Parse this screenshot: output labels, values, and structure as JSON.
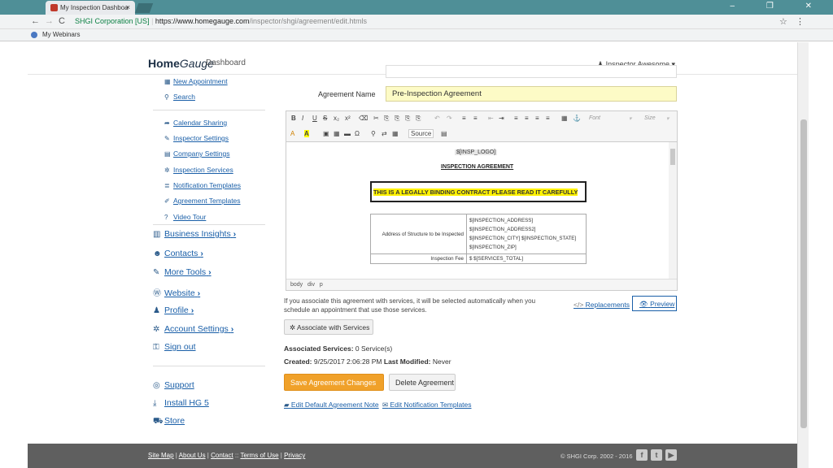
{
  "browser": {
    "tab_title": "My Inspection Dashboa",
    "tab_close": "×",
    "window_controls": "– ❐ ✕",
    "nav_back": "←",
    "nav_forward": "→",
    "nav_reload": "C",
    "secure_label": "SHGI Corporation [US]",
    "url_domain": "https://www.homegauge.com",
    "url_path": "/inspector/shgi/agreement/edit.htmls",
    "bookmark": "My Webinars",
    "star": "☆",
    "menu": "⋮"
  },
  "header": {
    "logo_home": "Home",
    "logo_gauge": "Gauge",
    "logo_sub": "Dashboard",
    "user": "Inspector Awesome"
  },
  "sidebar": {
    "links": [
      {
        "label": "New Appointment",
        "icon": "calendar-icon",
        "glyph": "▦"
      },
      {
        "label": "Search",
        "icon": "search-icon",
        "glyph": "⚲"
      },
      {
        "label": "Calendar Sharing",
        "icon": "share-icon",
        "glyph": "➦"
      },
      {
        "label": "Inspector Settings",
        "icon": "wrench-icon",
        "glyph": "✎"
      },
      {
        "label": "Company Settings",
        "icon": "building-icon",
        "glyph": "▤"
      },
      {
        "label": "Inspection Services",
        "icon": "gear-icon",
        "glyph": "✲"
      },
      {
        "label": "Notification Templates",
        "icon": "list-icon",
        "glyph": "≣"
      },
      {
        "label": "Agreement Templates",
        "icon": "edit-icon",
        "glyph": "✐"
      },
      {
        "label": "Video Tour",
        "icon": "help-icon",
        "glyph": "?"
      }
    ],
    "big_links": [
      {
        "label": "Business Insights",
        "icon": "chart-icon",
        "glyph": "▥"
      },
      {
        "label": "Contacts",
        "icon": "users-icon",
        "glyph": "☻"
      },
      {
        "label": "More Tools",
        "icon": "wrench-icon",
        "glyph": "✎"
      },
      {
        "label": "Website",
        "icon": "wordpress-icon",
        "glyph": "Ⓦ"
      },
      {
        "label": "Profile",
        "icon": "user-icon",
        "glyph": "♟"
      },
      {
        "label": "Account Settings",
        "icon": "gear-icon",
        "glyph": "✲"
      },
      {
        "label": "Sign out",
        "icon": "lock-icon",
        "glyph": "⚿"
      }
    ],
    "support_links": [
      {
        "label": "Support",
        "icon": "lifebuoy-icon",
        "glyph": "◎"
      },
      {
        "label": "Install HG 5",
        "icon": "download-icon",
        "glyph": "⤓"
      },
      {
        "label": "Store",
        "icon": "cart-icon",
        "glyph": "⛟"
      }
    ]
  },
  "form": {
    "agreement_name_label": "Agreement Name",
    "agreement_name_value": "Pre-Inspection Agreement"
  },
  "editor": {
    "toolbar_row1": [
      "B",
      "I",
      "U",
      "S",
      "x₂",
      "x²",
      "⌫",
      "✂",
      "⎘",
      "⎘",
      "⎘",
      "⎘",
      "↶",
      "↷",
      "≡",
      "≡",
      "⇤",
      "⇥",
      "≡",
      "≡",
      "≡",
      "≡",
      "▦",
      "⚓"
    ],
    "font_label": "Font",
    "size_label": "Size",
    "toolbar_row2": [
      "A",
      "A",
      "▣",
      "▦",
      "▬",
      "Ω",
      "⚲",
      "⇄",
      "▦"
    ],
    "source_label": "Source",
    "doc": {
      "logo_tag": "$[INSP_LOGO]",
      "heading": "INSPECTION AGREEMENT",
      "contract_line": "THIS IS A LEGALLY BINDING CONTRACT PLEASE READ IT CAREFULLY",
      "address_label": "Address of Structure to be Inspected",
      "address_values": [
        "$[INSPECTION_ADDRESS]",
        "$[INSPECTION_ADDRESS2]",
        "$[INSPECTION_CITY] $[INSPECTION_STATE]",
        "$[INSPECTION_ZIP]"
      ],
      "fee_label": "Inspection Fee",
      "fee_value": "$ $[SERVICES_TOTAL]"
    },
    "path": [
      "body",
      "div",
      "p"
    ]
  },
  "associate": {
    "note": "If you associate this agreement with services, it will be selected automatically when you schedule an appointment that use those services.",
    "replacements": "Replacements",
    "preview": "Preview",
    "button": "Associate with Services",
    "services_label": "Associated Services:",
    "services_value": "0 Service(s)",
    "created_label": "Created:",
    "created_value": "9/25/2017 2:06:28 PM",
    "modified_label": "Last Modified:",
    "modified_value": "Never"
  },
  "actions": {
    "save": "Save Agreement Changes",
    "delete": "Delete Agreement",
    "edit_note": "Edit Default Agreement Note",
    "edit_templates": "Edit Notification Templates"
  },
  "footer": {
    "links": [
      "Site Map",
      "About Us",
      "Contact",
      "Terms of Use",
      "Privacy"
    ],
    "copyright": "© SHGI Corp. 2002 - 2016",
    "social": [
      "f",
      "t",
      "▶"
    ]
  },
  "colors": {
    "accent": "#1a5fa8",
    "save": "#f0a12a",
    "highlight": "#fff200",
    "input_bg": "#fdfbc6",
    "tab_bar": "#4f8f97",
    "footer": "#5f5f5f"
  }
}
